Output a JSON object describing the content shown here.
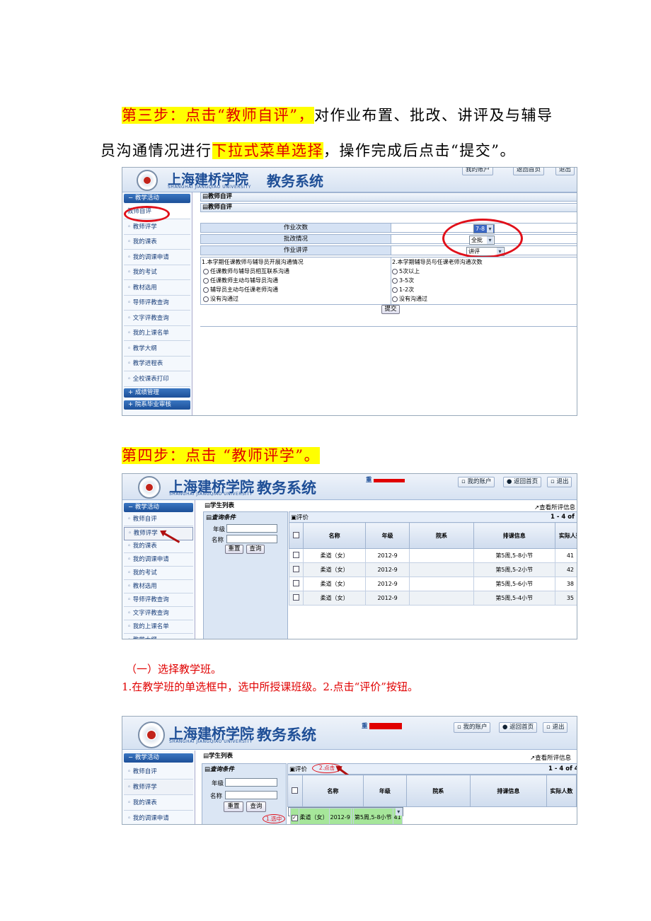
{
  "step3": {
    "prefix": "第三步：点击“教师自评”，",
    "rest": "对作业布置、批改、讲评及与辅导",
    "line2_a": "员沟通情况进行",
    "line2_hl": "下拉式菜单选择",
    "line2_b": "，操作完成后点击“提交”。"
  },
  "step4": {
    "text": "第四步：点击  “教师评学”。"
  },
  "sub1": {
    "heading": "（一）选择教学班。",
    "body": "1.在教学班的单选框中，选中所授课班级。2.点击“评价”按钮。"
  },
  "app": {
    "school_cn": "上海建桥学院",
    "school_en": "SHANGHAI JIANGQIAO UNIVERSITY",
    "system": "教务系统",
    "top_links": [
      "我的账户",
      "返回首页",
      "退出"
    ],
    "user_initial": "重"
  },
  "sidebar": {
    "group1": "教学活动",
    "items": [
      "教师自评",
      "教师评学",
      "我的课表",
      "我的调课申请",
      "我的考试",
      "教材选用",
      "导师评教查询",
      "文字评教查询",
      "我的上课名单",
      "教学大纲",
      "教学进程表",
      "全校课表打印"
    ],
    "group2": "成绩管理",
    "group3": "院系毕业审核"
  },
  "self_eval": {
    "panel_title": "教师自评",
    "inner_title": "教师自评",
    "rows": [
      {
        "label": "作业次数",
        "value": "7-8"
      },
      {
        "label": "批改情况",
        "value": "全批"
      },
      {
        "label": "作业讲评",
        "value": "讲评"
      }
    ],
    "q1": "1.本学期任课教师与辅导员开展沟通情况",
    "q1_options": [
      "任课教师与辅导员相互联系沟通",
      "任课教师主动与辅导员沟通",
      "辅导员主动与任课老师沟通",
      "没有沟通过"
    ],
    "q2": "2.本学期辅导员与任课老师沟通次数",
    "q2_options": [
      "5次以上",
      "3-5次",
      "1-2次",
      "没有沟通过"
    ],
    "submit": "提交"
  },
  "student_list": {
    "title": "学生列表",
    "view_link": "查看所评信息",
    "query_title": "查询条件",
    "grade_label": "年级",
    "name_label": "名称",
    "reset": "重置",
    "search": "查询",
    "eval_button": "评价",
    "paging": "1 - 4 of 4",
    "columns": [
      "名称",
      "年级",
      "院系",
      "排课信息",
      "实际人数"
    ],
    "rows": [
      {
        "name": "柔道（女）",
        "grade": "2012-9",
        "dept": "",
        "schedule": "第5周,5-8小节",
        "count": "41"
      },
      {
        "name": "柔道（女）",
        "grade": "2012-9",
        "dept": "",
        "schedule": "第5周,5-2小节",
        "count": "42"
      },
      {
        "name": "柔道（女）",
        "grade": "2012-9",
        "dept": "",
        "schedule": "第5周,5-6小节",
        "count": "38"
      },
      {
        "name": "柔道（女）",
        "grade": "2012-9",
        "dept": "",
        "schedule": "第5周,5-4小节",
        "count": "35"
      }
    ],
    "note_select": "1.选中",
    "note_click": "2.点击"
  },
  "colors": {
    "highlight": "#ffff00",
    "red_text": "#e00000",
    "brand_blue": "#1f4f97"
  }
}
